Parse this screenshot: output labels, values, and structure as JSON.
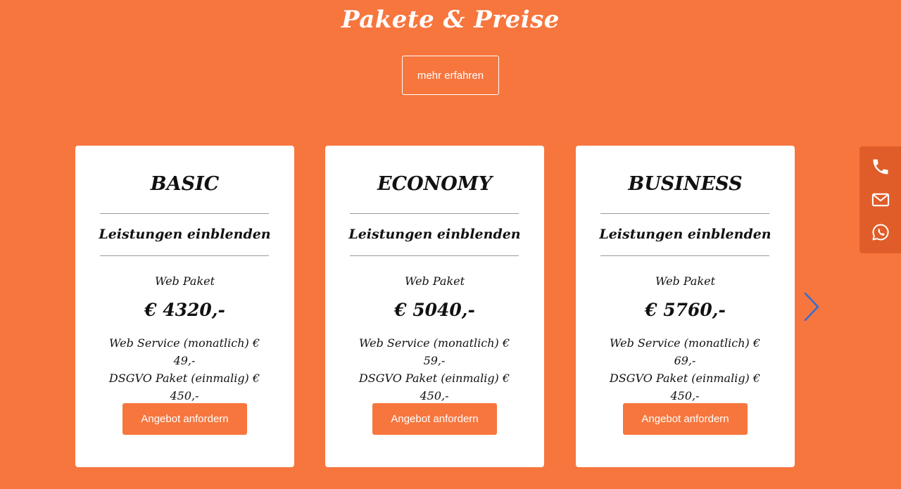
{
  "section": {
    "title": "Pakete & Preise",
    "more_label": "mehr erfahren"
  },
  "packages": [
    {
      "name": "BASIC",
      "services_toggle": "Leistungen einblenden",
      "package_label": "Web Paket",
      "price": "€ 4320,-",
      "extras_line_1": "Web Service (monatlich) € 49,-",
      "extras_line_2": "DSGVO Paket (einmalig) € 450,-",
      "button_label": "Angebot anfordern"
    },
    {
      "name": "ECONOMY",
      "services_toggle": "Leistungen einblenden",
      "package_label": "Web Paket",
      "price": "€ 5040,-",
      "extras_line_1": "Web Service (monatlich) € 59,-",
      "extras_line_2": "DSGVO Paket (einmalig) € 450,-",
      "button_label": "Angebot anfordern"
    },
    {
      "name": "BUSINESS",
      "services_toggle": "Leistungen einblenden",
      "package_label": "Web Paket",
      "price": "€ 5760,-",
      "extras_line_1": "Web Service (monatlich) € 69,-",
      "extras_line_2": "DSGVO Paket (einmalig) € 450,-",
      "button_label": "Angebot anfordern"
    }
  ],
  "carousel": {
    "prev_icon": "chevron-left-icon",
    "next_icon": "chevron-right-icon",
    "prev_color": "#a9c8ef",
    "next_color": "#2f6fd6"
  },
  "contact_bar": {
    "icons": [
      "phone-icon",
      "mail-icon",
      "whatsapp-icon"
    ],
    "background": "#e05d2a"
  },
  "colors": {
    "accent": "#f7763e",
    "card_background": "#ffffff",
    "text": "#111111"
  }
}
